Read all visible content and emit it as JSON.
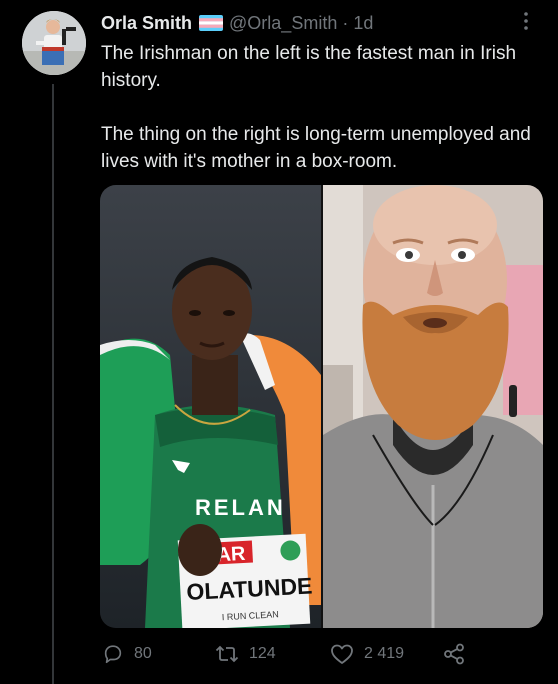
{
  "author": {
    "display_name": "Orla Smith",
    "flag_emoji_name": "transgender-flag-icon",
    "handle": "@Orla_Smith",
    "separator": "·",
    "time_ago": "1d"
  },
  "tweet": {
    "paragraphs": [
      "The Irishman on the left is the fastest man in Irish history.",
      "The thing on the right is long-term unemployed and lives with it's mother in a box-room."
    ]
  },
  "media": {
    "left_photo": {
      "bib_text": "OLATUNDE",
      "shirt_text": "RELAN",
      "sponsor_text": "AR",
      "run_clean_text": "I RUN CLEAN"
    }
  },
  "actions": {
    "replies": "80",
    "retweets": "124",
    "likes": "2 419"
  },
  "colors": {
    "background": "#000000",
    "text_primary": "#e7e9ea",
    "text_secondary": "#71767b",
    "thread_line": "#333639"
  }
}
